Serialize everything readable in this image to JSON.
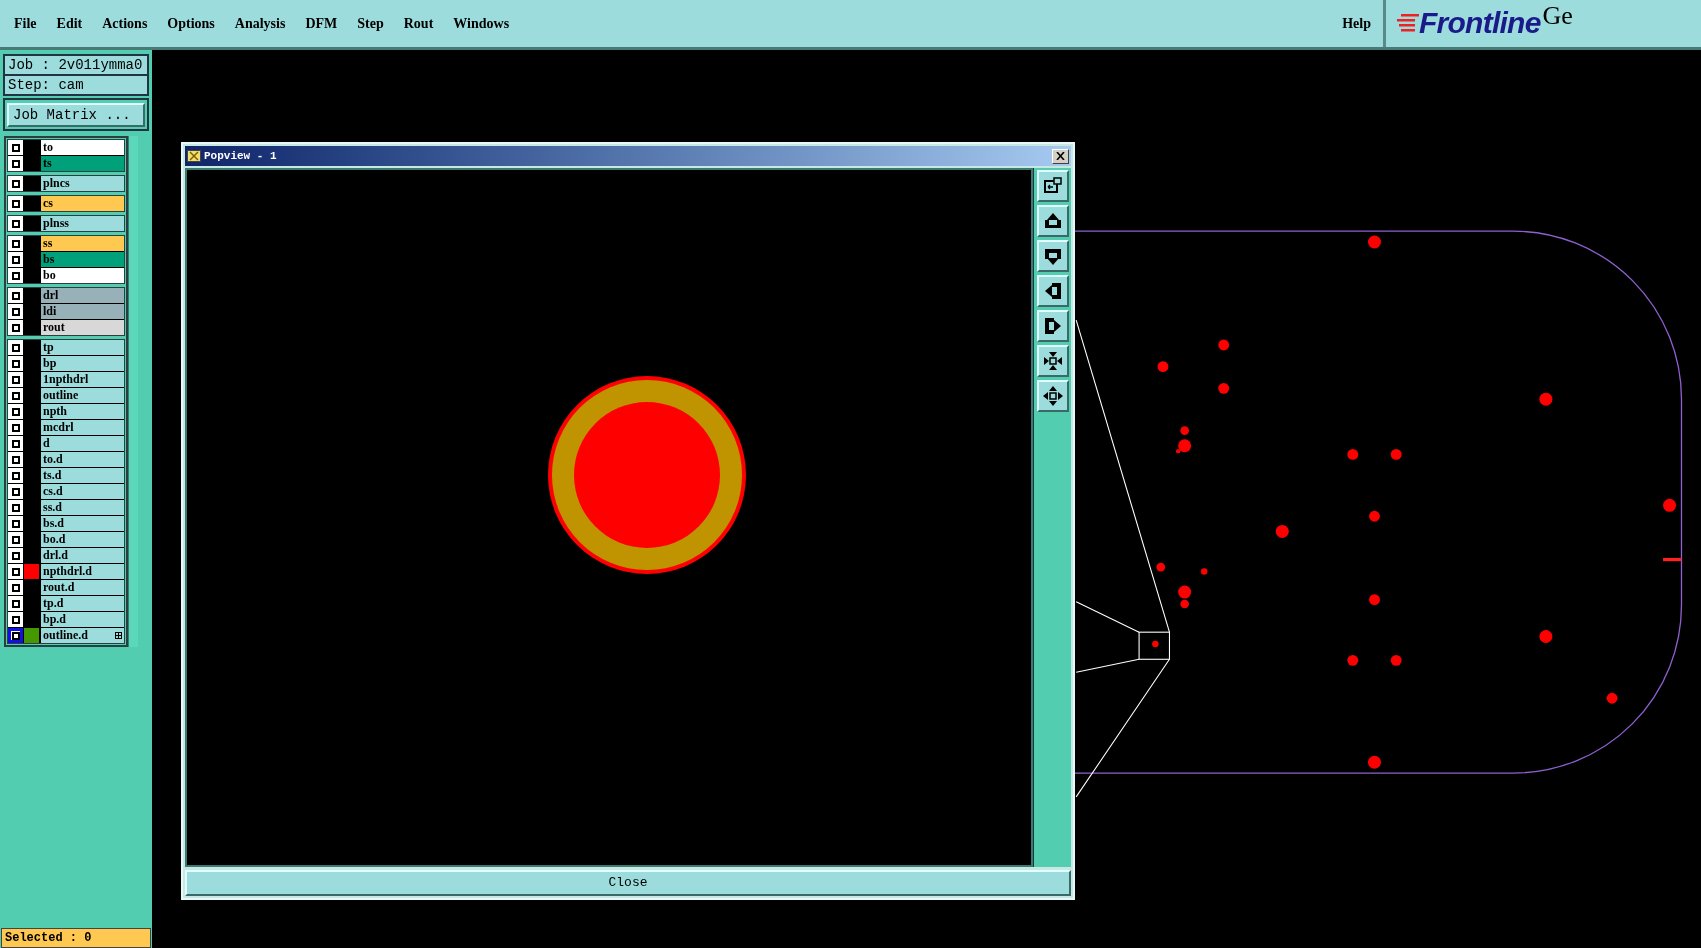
{
  "menu": [
    {
      "label": "File"
    },
    {
      "label": "Edit"
    },
    {
      "label": "Actions"
    },
    {
      "label": "Options"
    },
    {
      "label": "Analysis"
    },
    {
      "label": "DFM"
    },
    {
      "label": "Step"
    },
    {
      "label": "Rout"
    },
    {
      "label": "Windows"
    }
  ],
  "help": "Help",
  "logo": {
    "brand": "Frontline",
    "tail": "Ge"
  },
  "job": {
    "job_line": "Job : 2v011ymma0",
    "step_line": "Step: cam",
    "matrix_button": "Job Matrix ..."
  },
  "layer_groups": [
    {
      "layers": [
        {
          "name": "to",
          "color": "#ffffff",
          "focused": false
        },
        {
          "name": "ts",
          "color": "#00a07a",
          "focused": false
        }
      ]
    },
    {
      "layers": [
        {
          "name": "plncs",
          "color": "#9cdcdc",
          "focused": false
        }
      ]
    },
    {
      "layers": [
        {
          "name": "cs",
          "color": "#ffc850",
          "focused": false
        }
      ]
    },
    {
      "layers": [
        {
          "name": "plnss",
          "color": "#9cdcdc",
          "focused": false
        }
      ]
    },
    {
      "layers": [
        {
          "name": "ss",
          "color": "#ffc850",
          "focused": false
        },
        {
          "name": "bs",
          "color": "#00a07a",
          "focused": false
        },
        {
          "name": "bo",
          "color": "#ffffff",
          "focused": false
        }
      ]
    },
    {
      "layers": [
        {
          "name": "drl",
          "color": "#98b0b8",
          "focused": false
        },
        {
          "name": "ldi",
          "color": "#98b0b8",
          "focused": false
        },
        {
          "name": "rout",
          "color": "#d8d8d8",
          "focused": false
        }
      ]
    },
    {
      "layers": [
        {
          "name": "tp",
          "color": "#9cdcdc",
          "focused": false
        },
        {
          "name": "bp",
          "color": "#9cdcdc",
          "focused": false
        },
        {
          "name": "1npthdrl",
          "color": "#9cdcdc",
          "focused": false
        },
        {
          "name": "outline",
          "color": "#9cdcdc",
          "focused": false
        },
        {
          "name": "npth",
          "color": "#9cdcdc",
          "focused": false
        },
        {
          "name": "mcdrl",
          "color": "#9cdcdc",
          "focused": false
        },
        {
          "name": "d",
          "color": "#9cdcdc",
          "focused": false
        },
        {
          "name": "to.d",
          "color": "#9cdcdc",
          "focused": false
        },
        {
          "name": "ts.d",
          "color": "#9cdcdc",
          "focused": false
        },
        {
          "name": "cs.d",
          "color": "#9cdcdc",
          "focused": false
        },
        {
          "name": "ss.d",
          "color": "#9cdcdc",
          "focused": false
        },
        {
          "name": "bs.d",
          "color": "#9cdcdc",
          "focused": false
        },
        {
          "name": "bo.d",
          "color": "#9cdcdc",
          "focused": false
        },
        {
          "name": "drl.d",
          "color": "#9cdcdc",
          "focused": false
        },
        {
          "name": "npthdrl.d",
          "color": "#9cdcdc",
          "swatch": {
            "color": "#ff0000"
          },
          "focused": false
        },
        {
          "name": "rout.d",
          "color": "#9cdcdc",
          "focused": false
        },
        {
          "name": "tp.d",
          "color": "#9cdcdc",
          "focused": false
        },
        {
          "name": "bp.d",
          "color": "#9cdcdc",
          "focused": false
        },
        {
          "name": "outline.d",
          "color": "#9cdcdc",
          "swatch": {
            "color": "#449900"
          },
          "focused": true,
          "has_attributes": true
        }
      ]
    }
  ],
  "status": "Selected : 0",
  "popview": {
    "title": "Popview - 1",
    "close_button": "Close"
  }
}
